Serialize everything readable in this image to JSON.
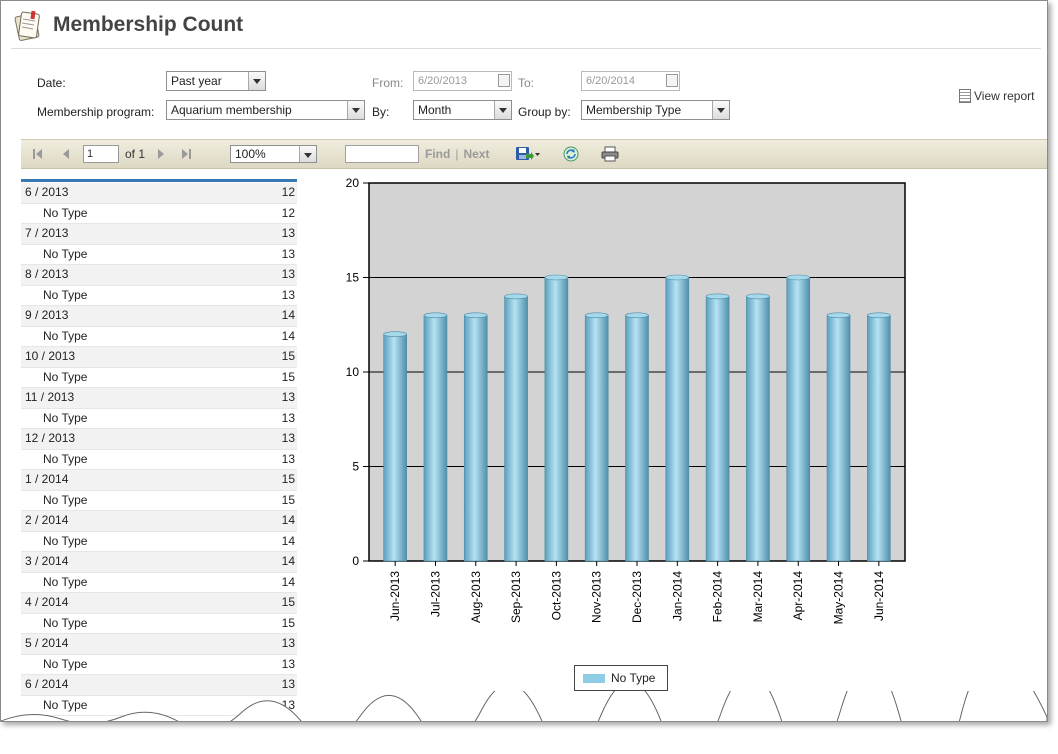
{
  "header": {
    "title": "Membership Count"
  },
  "filters": {
    "date_label": "Date:",
    "date_value": "Past year",
    "from_label": "From:",
    "from_value": "6/20/2013",
    "to_label": "To:",
    "to_value": "6/20/2014",
    "program_label": "Membership program:",
    "program_value": "Aquarium membership",
    "by_label": "By:",
    "by_value": "Month",
    "groupby_label": "Group by:",
    "groupby_value": "Membership Type",
    "view_report": "View report"
  },
  "toolbar": {
    "page_value": "1",
    "page_of": "of 1",
    "zoom": "100%",
    "find": "Find",
    "separator": "|",
    "next": "Next"
  },
  "table": {
    "rows": [
      {
        "label": "6 / 2013",
        "value": "12",
        "sub_label": "No Type",
        "sub_value": "12"
      },
      {
        "label": "7 / 2013",
        "value": "13",
        "sub_label": "No Type",
        "sub_value": "13"
      },
      {
        "label": "8 / 2013",
        "value": "13",
        "sub_label": "No Type",
        "sub_value": "13"
      },
      {
        "label": "9 / 2013",
        "value": "14",
        "sub_label": "No Type",
        "sub_value": "14"
      },
      {
        "label": "10 / 2013",
        "value": "15",
        "sub_label": "No Type",
        "sub_value": "15"
      },
      {
        "label": "11 / 2013",
        "value": "13",
        "sub_label": "No Type",
        "sub_value": "13"
      },
      {
        "label": "12 / 2013",
        "value": "13",
        "sub_label": "No Type",
        "sub_value": "13"
      },
      {
        "label": "1 / 2014",
        "value": "15",
        "sub_label": "No Type",
        "sub_value": "15"
      },
      {
        "label": "2 / 2014",
        "value": "14",
        "sub_label": "No Type",
        "sub_value": "14"
      },
      {
        "label": "3 / 2014",
        "value": "14",
        "sub_label": "No Type",
        "sub_value": "14"
      },
      {
        "label": "4 / 2014",
        "value": "15",
        "sub_label": "No Type",
        "sub_value": "15"
      },
      {
        "label": "5 / 2014",
        "value": "13",
        "sub_label": "No Type",
        "sub_value": "13"
      },
      {
        "label": "6 / 2014",
        "value": "13",
        "sub_label": "No Type",
        "sub_value": "13"
      }
    ]
  },
  "chart_data": {
    "type": "bar",
    "categories": [
      "Jun-2013",
      "Jul-2013",
      "Aug-2013",
      "Sep-2013",
      "Oct-2013",
      "Nov-2013",
      "Dec-2013",
      "Jan-2014",
      "Feb-2014",
      "Mar-2014",
      "Apr-2014",
      "May-2014",
      "Jun-2014"
    ],
    "series": [
      {
        "name": "No Type",
        "values": [
          12,
          13,
          13,
          14,
          15,
          13,
          13,
          15,
          14,
          14,
          15,
          13,
          13
        ]
      }
    ],
    "yticks": [
      "0",
      "5",
      "10",
      "15",
      "20"
    ],
    "ylim": [
      0,
      20
    ],
    "grid": true,
    "legend": "bottom",
    "colors": {
      "bar": "#8fcde6",
      "bar_dark": "#5a9fbd",
      "plot_bg": "#d3d3d3"
    }
  }
}
